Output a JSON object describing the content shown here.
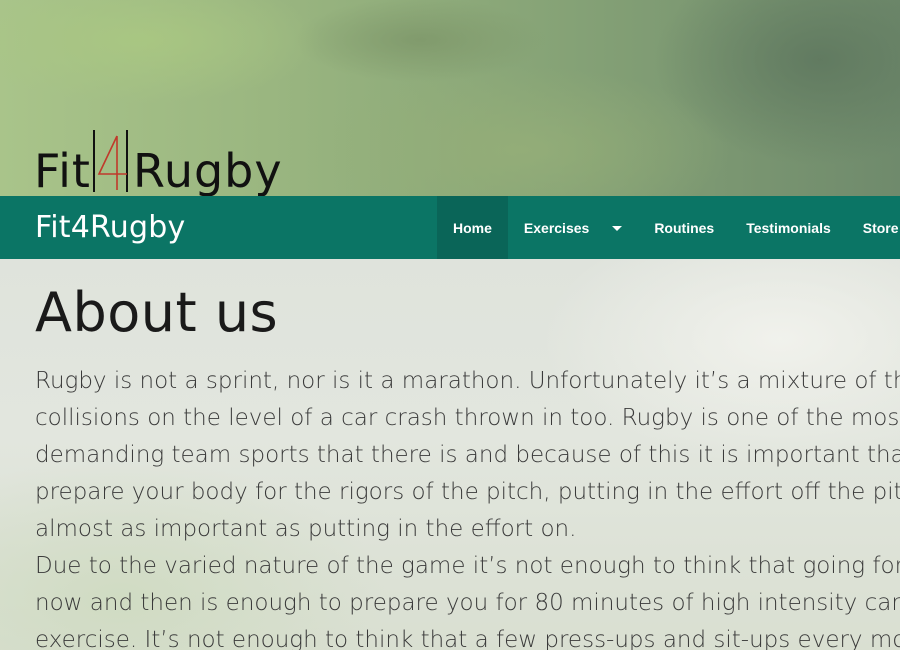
{
  "header": {
    "logo": {
      "text_left": "Fit",
      "text_right": "Rugby",
      "mark_icon": "rugby-posts-4-icon",
      "mark_color": "#c0392b"
    }
  },
  "navbar": {
    "brand": "Fit4Rugby",
    "background": "#0b7565",
    "items": [
      {
        "label": "Home",
        "active": true
      },
      {
        "label": "Exercises",
        "has_dropdown": true
      },
      {
        "label": "Routines"
      },
      {
        "label": "Testimonials"
      },
      {
        "label": "Store"
      }
    ]
  },
  "main": {
    "title": "About us",
    "lines": [
      "Rugby is not a sprint, nor is it a marathon. Unfortunately it’s a mixture of the two",
      "collisions on the level of a car crash thrown in too. Rugby is one of the most phy",
      "demanding team sports that there is and because of this it is important that you",
      "prepare your body for the rigors of the pitch, putting in the effort off the pitch is",
      "almost as important as putting in the effort on.",
      "Due to the varied nature of the game it’s not enough to think that going for a jog",
      "now and then is enough to prepare you for 80 minutes of high intensity cardiova",
      "exercise. It’s not enough to think that a few press-ups and sit-ups every mornino"
    ]
  }
}
